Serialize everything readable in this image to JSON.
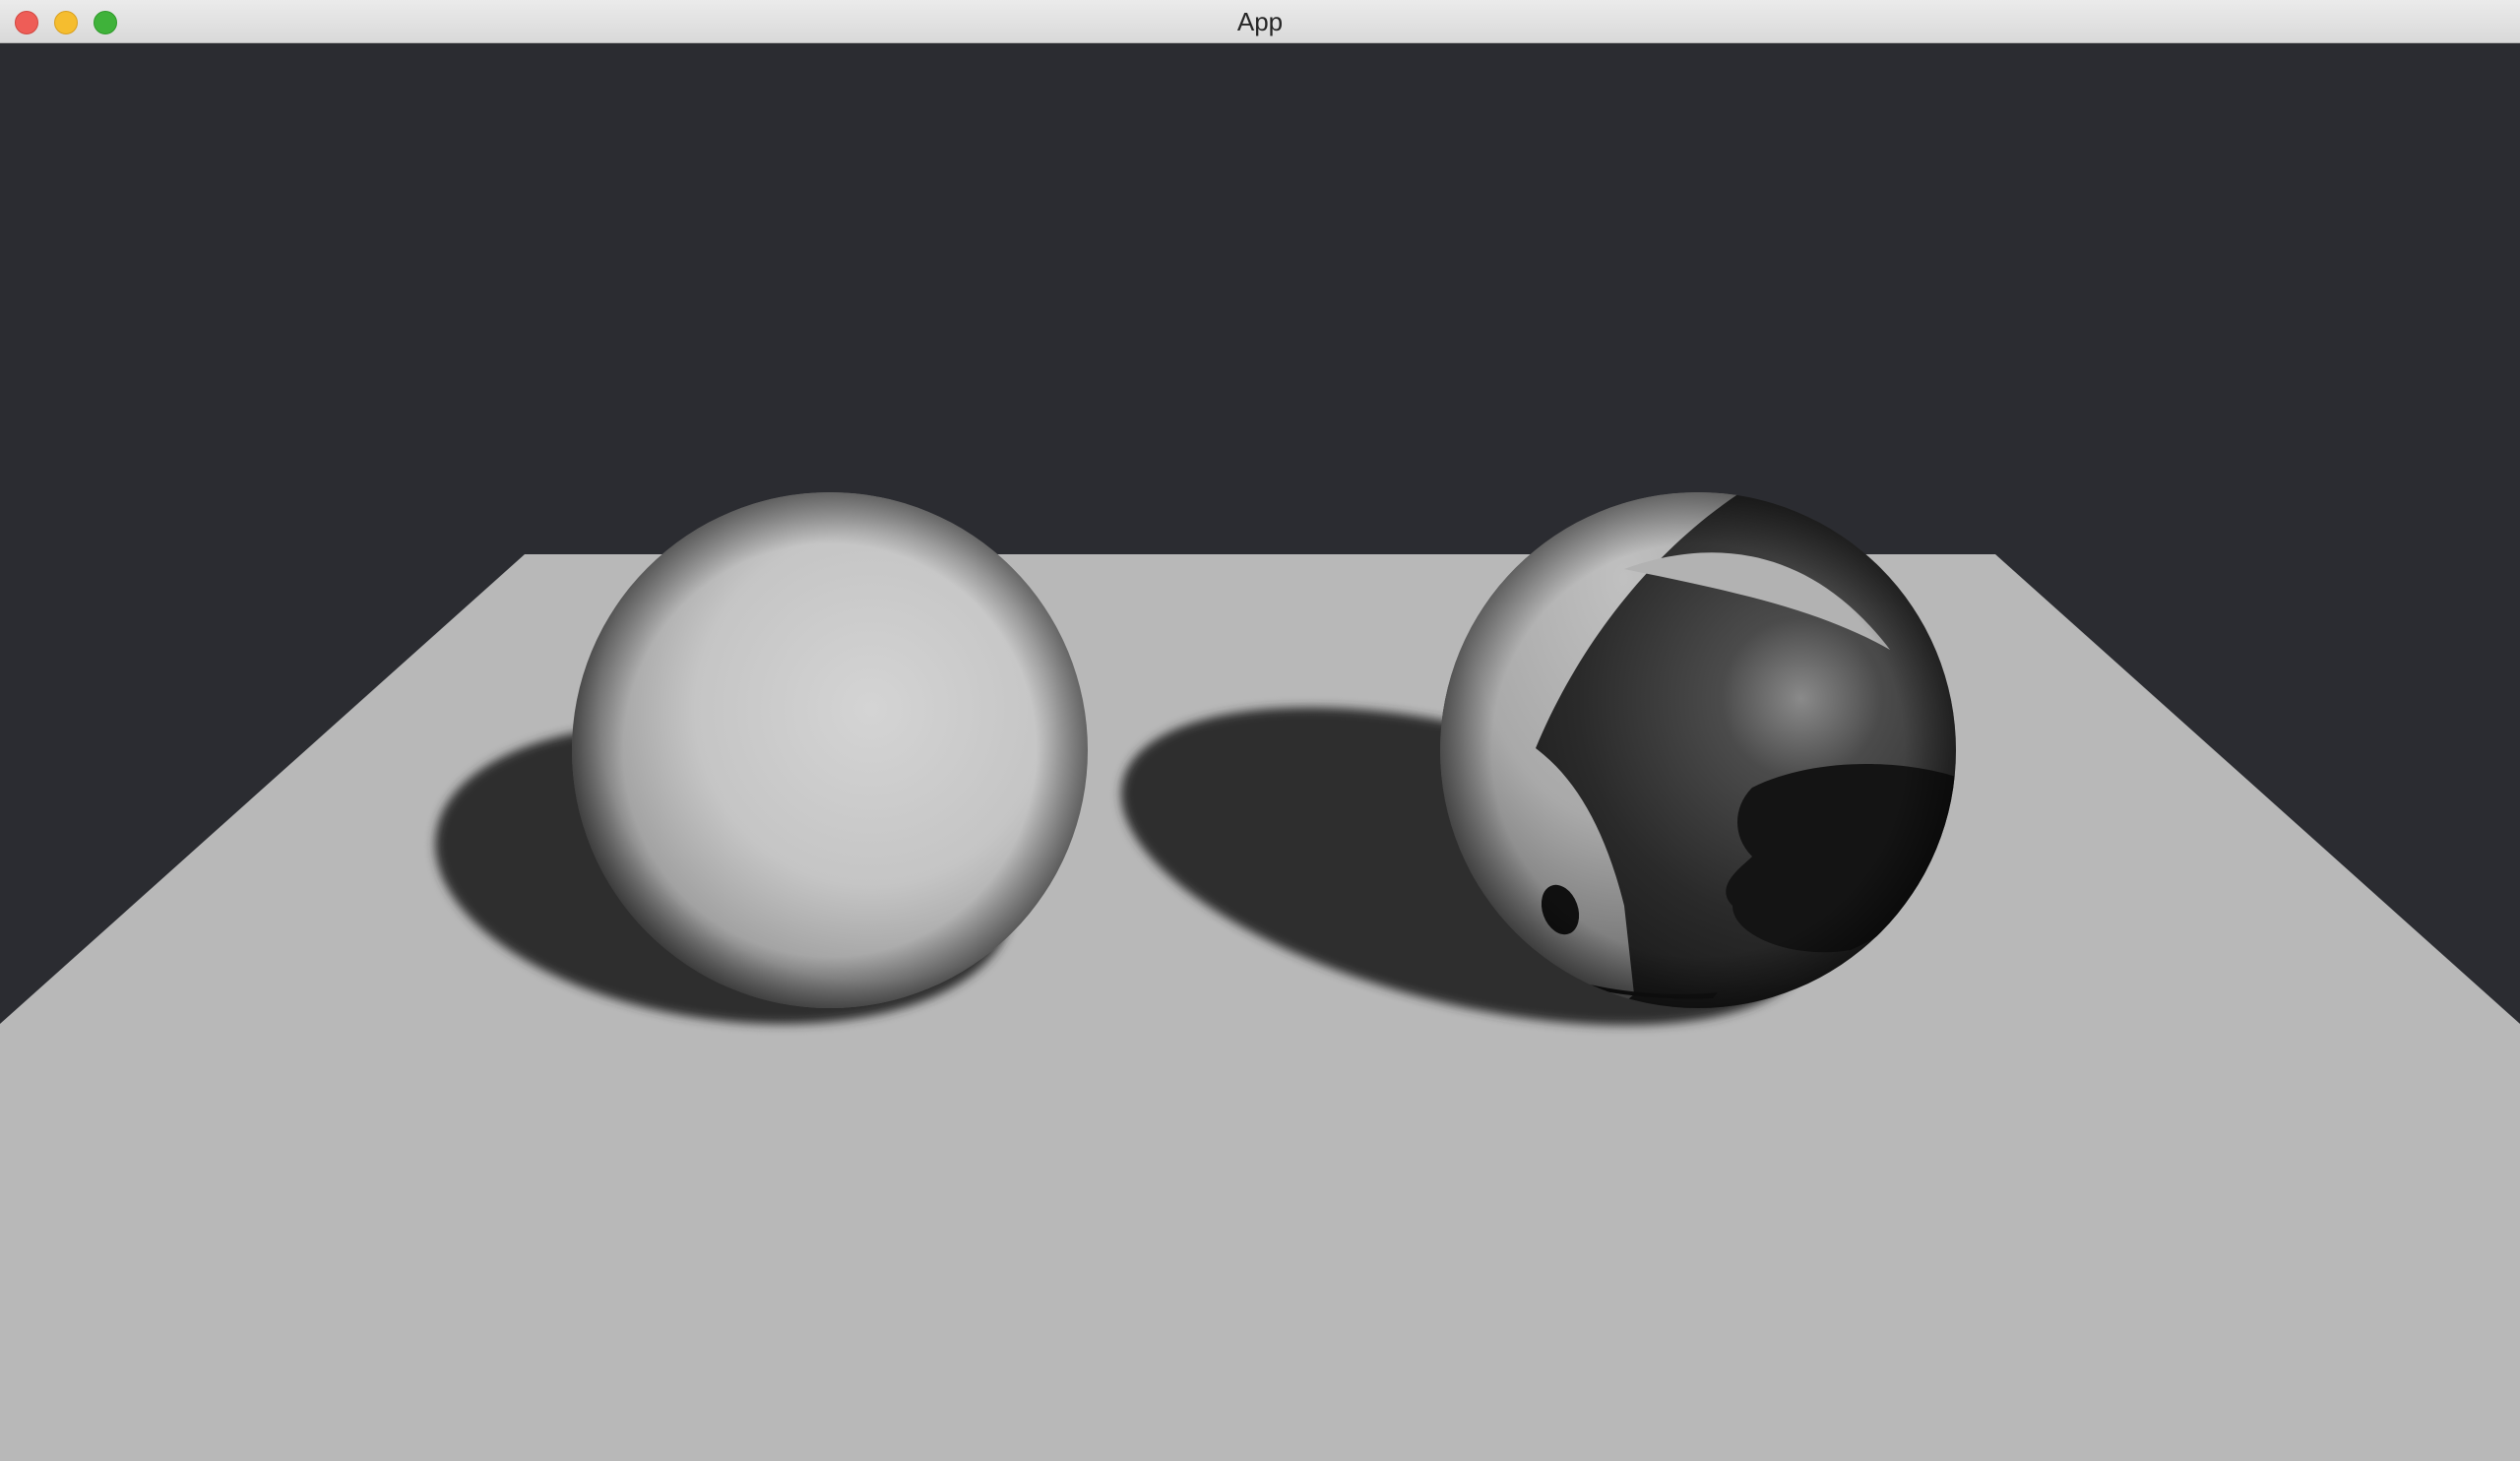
{
  "window": {
    "title": "App",
    "controls": [
      "close",
      "minimize",
      "zoom"
    ]
  },
  "scene": {
    "background_color": "#2b2c31",
    "floor_color": "#b8b8b8",
    "shadow_color": "#2e2e2e",
    "objects": [
      "plain-sphere",
      "textured-sphere"
    ]
  }
}
